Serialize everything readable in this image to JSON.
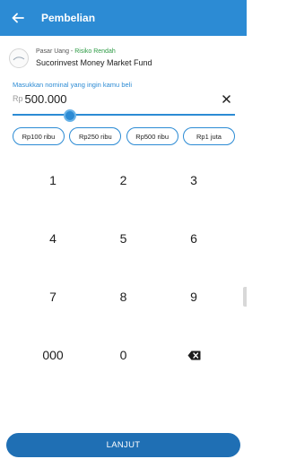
{
  "header": {
    "title": "Pembelian",
    "back_icon": "arrow-left-icon"
  },
  "fund": {
    "category": "Pasar Uang",
    "separator": " - ",
    "risk": "Risiko Rendah",
    "name": "Sucorinvest Money Market Fund",
    "risk_color": "#2e9b45"
  },
  "amount": {
    "label": "Masukkan nominal yang ingin kamu beli",
    "currency": "Rp",
    "value": "500.000"
  },
  "presets": [
    "Rp100 ribu",
    "Rp250 ribu",
    "Rp500 ribu",
    "Rp1 juta"
  ],
  "keypad": {
    "row1": [
      "1",
      "2",
      "3"
    ],
    "row2": [
      "4",
      "5",
      "6"
    ],
    "row3": [
      "7",
      "8",
      "9"
    ],
    "row4": [
      "000",
      "0"
    ],
    "backspace_icon": "backspace-icon"
  },
  "cta": {
    "label": "LANJUT"
  },
  "colors": {
    "primary": "#2c8bd4",
    "cta": "#1f6fb4"
  }
}
